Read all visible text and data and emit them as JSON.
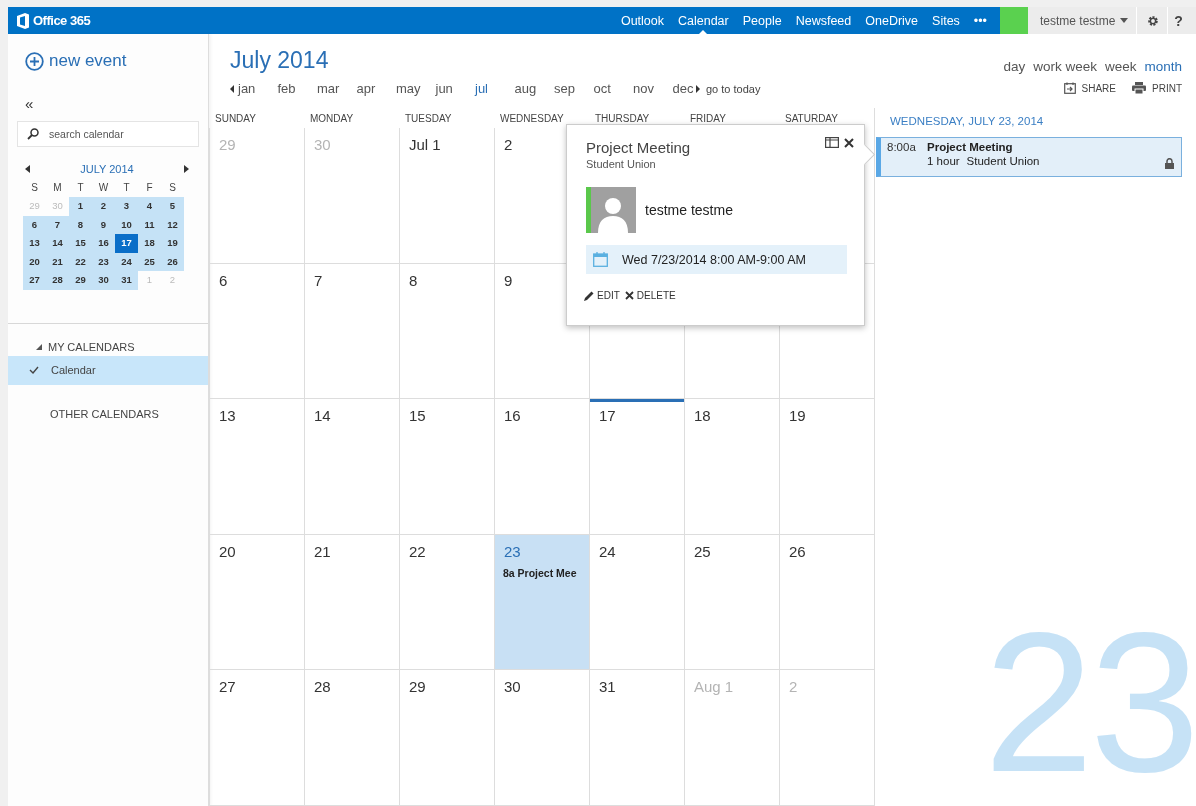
{
  "top_bar": {
    "logo": "Office 365",
    "nav": [
      {
        "label": "Outlook",
        "selected": false
      },
      {
        "label": "Calendar",
        "selected": true
      },
      {
        "label": "People",
        "selected": false
      },
      {
        "label": "Newsfeed",
        "selected": false
      },
      {
        "label": "OneDrive",
        "selected": false
      },
      {
        "label": "Sites",
        "selected": false
      },
      {
        "label": "•••",
        "selected": false
      }
    ],
    "user": "testme testme",
    "help": "?"
  },
  "sidebar": {
    "new_event": "new event",
    "collapse": "«",
    "search": {
      "placeholder": "search calendar"
    },
    "mini_calendar": {
      "title": "JULY 2014",
      "weekdays": [
        "S",
        "M",
        "T",
        "W",
        "T",
        "F",
        "S"
      ],
      "weeks": [
        [
          {
            "label": "29",
            "muted": true,
            "in_view": false,
            "selected": false
          },
          {
            "label": "30",
            "muted": true,
            "in_view": false,
            "selected": false
          },
          {
            "label": "1",
            "muted": false,
            "in_view": true,
            "selected": false
          },
          {
            "label": "2",
            "muted": false,
            "in_view": true,
            "selected": false
          },
          {
            "label": "3",
            "muted": false,
            "in_view": true,
            "selected": false
          },
          {
            "label": "4",
            "muted": false,
            "in_view": true,
            "selected": false
          },
          {
            "label": "5",
            "muted": false,
            "in_view": true,
            "selected": false
          }
        ],
        [
          {
            "label": "6",
            "muted": false,
            "in_view": true,
            "selected": false
          },
          {
            "label": "7",
            "muted": false,
            "in_view": true,
            "selected": false
          },
          {
            "label": "8",
            "muted": false,
            "in_view": true,
            "selected": false
          },
          {
            "label": "9",
            "muted": false,
            "in_view": true,
            "selected": false
          },
          {
            "label": "10",
            "muted": false,
            "in_view": true,
            "selected": false
          },
          {
            "label": "11",
            "muted": false,
            "in_view": true,
            "selected": false
          },
          {
            "label": "12",
            "muted": false,
            "in_view": true,
            "selected": false
          }
        ],
        [
          {
            "label": "13",
            "muted": false,
            "in_view": true,
            "selected": false
          },
          {
            "label": "14",
            "muted": false,
            "in_view": true,
            "selected": false
          },
          {
            "label": "15",
            "muted": false,
            "in_view": true,
            "selected": false
          },
          {
            "label": "16",
            "muted": false,
            "in_view": true,
            "selected": false
          },
          {
            "label": "17",
            "muted": false,
            "in_view": true,
            "selected": true
          },
          {
            "label": "18",
            "muted": false,
            "in_view": true,
            "selected": false
          },
          {
            "label": "19",
            "muted": false,
            "in_view": true,
            "selected": false
          }
        ],
        [
          {
            "label": "20",
            "muted": false,
            "in_view": true,
            "selected": false
          },
          {
            "label": "21",
            "muted": false,
            "in_view": true,
            "selected": false
          },
          {
            "label": "22",
            "muted": false,
            "in_view": true,
            "selected": false
          },
          {
            "label": "23",
            "muted": false,
            "in_view": true,
            "selected": false
          },
          {
            "label": "24",
            "muted": false,
            "in_view": true,
            "selected": false
          },
          {
            "label": "25",
            "muted": false,
            "in_view": true,
            "selected": false
          },
          {
            "label": "26",
            "muted": false,
            "in_view": true,
            "selected": false
          }
        ],
        [
          {
            "label": "27",
            "muted": false,
            "in_view": true,
            "selected": false
          },
          {
            "label": "28",
            "muted": false,
            "in_view": true,
            "selected": false
          },
          {
            "label": "29",
            "muted": false,
            "in_view": true,
            "selected": false
          },
          {
            "label": "30",
            "muted": false,
            "in_view": true,
            "selected": false
          },
          {
            "label": "31",
            "muted": false,
            "in_view": true,
            "selected": false
          },
          {
            "label": "1",
            "muted": true,
            "in_view": false,
            "selected": false
          },
          {
            "label": "2",
            "muted": true,
            "in_view": false,
            "selected": false
          }
        ]
      ]
    },
    "my_calendars": {
      "label": "MY CALENDARS",
      "expanded": true,
      "items": [
        {
          "label": "Calendar",
          "checked": true,
          "selected": true
        }
      ]
    },
    "other_calendars": "OTHER CALENDARS"
  },
  "header": {
    "title": "July 2014",
    "months": [
      {
        "label": "jan",
        "selected": false
      },
      {
        "label": "feb",
        "selected": false
      },
      {
        "label": "mar",
        "selected": false
      },
      {
        "label": "apr",
        "selected": false
      },
      {
        "label": "may",
        "selected": false
      },
      {
        "label": "jun",
        "selected": false
      },
      {
        "label": "jul",
        "selected": true
      },
      {
        "label": "aug",
        "selected": false
      },
      {
        "label": "sep",
        "selected": false
      },
      {
        "label": "oct",
        "selected": false
      },
      {
        "label": "nov",
        "selected": false
      },
      {
        "label": "dec",
        "selected": false
      }
    ],
    "go_to_today": "go to today",
    "views": [
      {
        "label": "day",
        "selected": false
      },
      {
        "label": "work week",
        "selected": false
      },
      {
        "label": "week",
        "selected": false
      },
      {
        "label": "month",
        "selected": true
      }
    ],
    "actions": [
      {
        "kind": "share",
        "label": "SHARE"
      },
      {
        "kind": "print",
        "label": "PRINT"
      }
    ]
  },
  "month_grid": {
    "weekdays": [
      "SUNDAY",
      "MONDAY",
      "TUESDAY",
      "WEDNESDAY",
      "THURSDAY",
      "FRIDAY",
      "SATURDAY"
    ],
    "weeks": [
      [
        {
          "label": "29",
          "muted": true,
          "today": false,
          "selected": false
        },
        {
          "label": "30",
          "muted": true,
          "today": false,
          "selected": false
        },
        {
          "label": "Jul 1",
          "muted": false,
          "today": false,
          "selected": false
        },
        {
          "label": "2",
          "muted": false,
          "today": false,
          "selected": false
        }
      ],
      [
        {
          "label": "6",
          "muted": false,
          "today": false,
          "selected": false
        },
        {
          "label": "7",
          "muted": false,
          "today": false,
          "selected": false
        },
        {
          "label": "8",
          "muted": false,
          "today": false,
          "selected": false
        },
        {
          "label": "9",
          "muted": false,
          "today": false,
          "selected": false
        }
      ],
      [
        {
          "label": "13",
          "muted": false,
          "today": false,
          "selected": false
        },
        {
          "label": "14",
          "muted": false,
          "today": false,
          "selected": false
        },
        {
          "label": "15",
          "muted": false,
          "today": false,
          "selected": false
        },
        {
          "label": "16",
          "muted": false,
          "today": false,
          "selected": false
        },
        {
          "label": "17",
          "muted": false,
          "today": true,
          "selected": false
        },
        {
          "label": "18",
          "muted": false,
          "today": false,
          "selected": false
        },
        {
          "label": "19",
          "muted": false,
          "today": false,
          "selected": false
        }
      ],
      [
        {
          "label": "20",
          "muted": false,
          "today": false,
          "selected": false
        },
        {
          "label": "21",
          "muted": false,
          "today": false,
          "selected": false
        },
        {
          "label": "22",
          "muted": false,
          "today": false,
          "selected": false
        },
        {
          "label": "23",
          "muted": false,
          "today": false,
          "selected": true,
          "events": [
            "8a Project Mee"
          ]
        },
        {
          "label": "24",
          "muted": false,
          "today": false,
          "selected": false
        },
        {
          "label": "25",
          "muted": false,
          "today": false,
          "selected": false
        },
        {
          "label": "26",
          "muted": false,
          "today": false,
          "selected": false
        }
      ],
      [
        {
          "label": "27",
          "muted": false,
          "today": false,
          "selected": false
        },
        {
          "label": "28",
          "muted": false,
          "today": false,
          "selected": false
        },
        {
          "label": "29",
          "muted": false,
          "today": false,
          "selected": false
        },
        {
          "label": "30",
          "muted": false,
          "today": false,
          "selected": false
        },
        {
          "label": "31",
          "muted": false,
          "today": false,
          "selected": false
        },
        {
          "label": "Aug 1",
          "muted": true,
          "today": false,
          "selected": false
        },
        {
          "label": "2",
          "muted": true,
          "today": false,
          "selected": false
        }
      ]
    ]
  },
  "event_popup": {
    "title": "Project Meeting",
    "location": "Student Union",
    "organizer": "testme testme",
    "time": "Wed 7/23/2014 8:00 AM-9:00 AM",
    "actions": [
      {
        "kind": "edit",
        "label": "EDIT"
      },
      {
        "kind": "delete",
        "label": "DELETE"
      }
    ]
  },
  "day_panel": {
    "heading": "WEDNESDAY, JULY 23, 2014",
    "events": [
      {
        "time": "8:00a",
        "title": "Project Meeting",
        "duration": "1 hour",
        "location": "Student Union",
        "private": true
      }
    ],
    "big_date": "23"
  }
}
